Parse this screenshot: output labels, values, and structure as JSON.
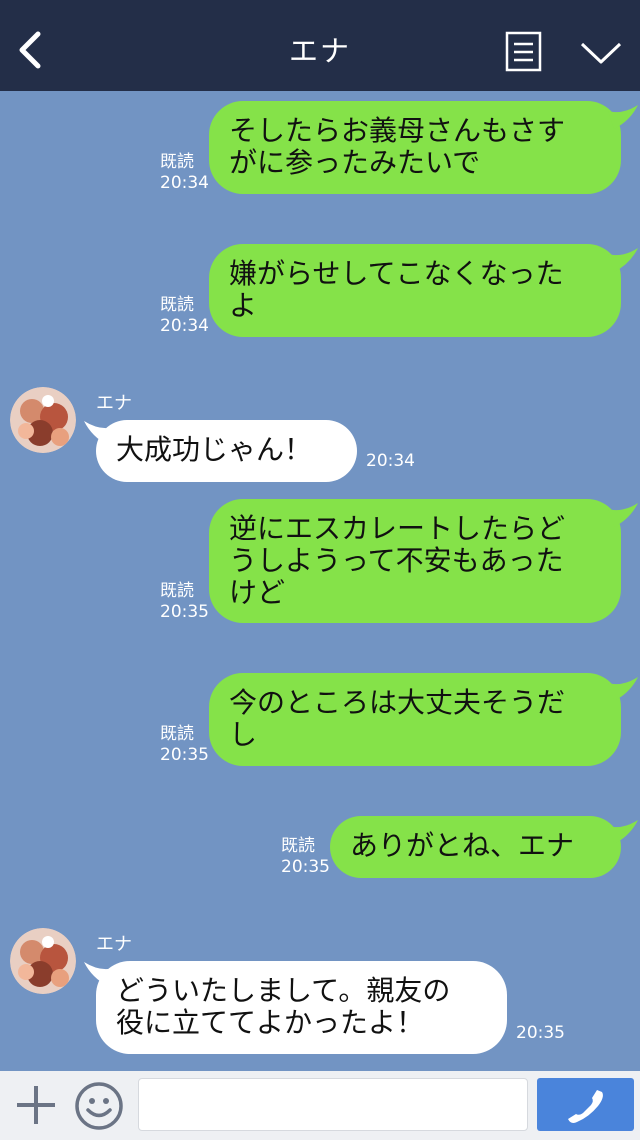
{
  "header": {
    "title": "エナ"
  },
  "contact": {
    "name": "エナ"
  },
  "messages": [
    {
      "direction": "out",
      "lines": [
        "そしたらお義母さんもさす",
        "がに参ったみたいで"
      ],
      "read": "既読",
      "time": "20:34"
    },
    {
      "direction": "out",
      "lines": [
        "嫌がらせしてこなくなった",
        "よ"
      ],
      "read": "既読",
      "time": "20:34"
    },
    {
      "direction": "in",
      "sender": "エナ",
      "lines": [
        "大成功じゃん！"
      ],
      "time": "20:34"
    },
    {
      "direction": "out",
      "lines": [
        "逆にエスカレートしたらど",
        "うしようって不安もあった",
        "けど"
      ],
      "read": "既読",
      "time": "20:35"
    },
    {
      "direction": "out",
      "lines": [
        "今のところは大丈夫そうだ",
        "し"
      ],
      "read": "既読",
      "time": "20:35"
    },
    {
      "direction": "out",
      "lines": [
        "ありがとね、エナ"
      ],
      "read": "既読",
      "time": "20:35"
    },
    {
      "direction": "in",
      "sender": "エナ",
      "lines": [
        "どういたしまして。親友の",
        "役に立ててよかったよ！"
      ],
      "time": "20:35"
    }
  ],
  "input": {
    "value": "",
    "placeholder": ""
  },
  "colors": {
    "header_bg": "#232e48",
    "chat_bg": "#7294c3",
    "outgoing_bubble": "#85e249",
    "incoming_bubble": "#ffffff",
    "call_button": "#4a84db"
  },
  "icons": [
    "back-arrow-icon",
    "menu-list-icon",
    "chevron-down-icon",
    "plus-icon",
    "emoji-icon",
    "phone-icon"
  ]
}
